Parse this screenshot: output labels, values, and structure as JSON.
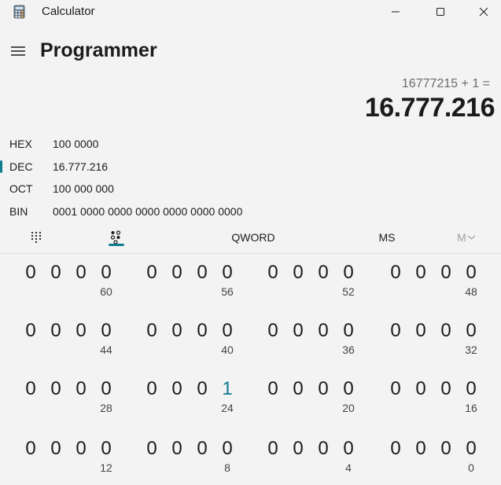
{
  "window": {
    "title": "Calculator"
  },
  "header": {
    "mode_title": "Programmer"
  },
  "display": {
    "expression": "16777215 + 1 =",
    "result": "16.777.216"
  },
  "radix": [
    {
      "label": "HEX",
      "value": "100 0000",
      "selected": false
    },
    {
      "label": "DEC",
      "value": "16.777.216",
      "selected": true
    },
    {
      "label": "OCT",
      "value": "100 000 000",
      "selected": false
    },
    {
      "label": "BIN",
      "value": "0001 0000 0000 0000 0000 0000 0000",
      "selected": false
    }
  ],
  "toolbar": {
    "keypad_icon": "keypad-icon",
    "bit_toggle_icon": "bit-toggling-icon",
    "word_size": "QWORD",
    "memory_store": "MS",
    "memory_recall": "M"
  },
  "colors": {
    "accent": "#0f7b8f",
    "background": "#f3f3f3",
    "text": "#1b1b1b"
  },
  "bits": {
    "rows": [
      {
        "groups": [
          {
            "digits": [
              "0",
              "0",
              "0",
              "0"
            ],
            "position": "60"
          },
          {
            "digits": [
              "0",
              "0",
              "0",
              "0"
            ],
            "position": "56"
          },
          {
            "digits": [
              "0",
              "0",
              "0",
              "0"
            ],
            "position": "52"
          },
          {
            "digits": [
              "0",
              "0",
              "0",
              "0"
            ],
            "position": "48"
          }
        ]
      },
      {
        "groups": [
          {
            "digits": [
              "0",
              "0",
              "0",
              "0"
            ],
            "position": "44"
          },
          {
            "digits": [
              "0",
              "0",
              "0",
              "0"
            ],
            "position": "40"
          },
          {
            "digits": [
              "0",
              "0",
              "0",
              "0"
            ],
            "position": "36"
          },
          {
            "digits": [
              "0",
              "0",
              "0",
              "0"
            ],
            "position": "32"
          }
        ]
      },
      {
        "groups": [
          {
            "digits": [
              "0",
              "0",
              "0",
              "0"
            ],
            "position": "28"
          },
          {
            "digits": [
              "0",
              "0",
              "0",
              "1"
            ],
            "position": "24"
          },
          {
            "digits": [
              "0",
              "0",
              "0",
              "0"
            ],
            "position": "20"
          },
          {
            "digits": [
              "0",
              "0",
              "0",
              "0"
            ],
            "position": "16"
          }
        ]
      },
      {
        "groups": [
          {
            "digits": [
              "0",
              "0",
              "0",
              "0"
            ],
            "position": "12"
          },
          {
            "digits": [
              "0",
              "0",
              "0",
              "0"
            ],
            "position": "8"
          },
          {
            "digits": [
              "0",
              "0",
              "0",
              "0"
            ],
            "position": "4"
          },
          {
            "digits": [
              "0",
              "0",
              "0",
              "0"
            ],
            "position": "0"
          }
        ]
      }
    ]
  }
}
